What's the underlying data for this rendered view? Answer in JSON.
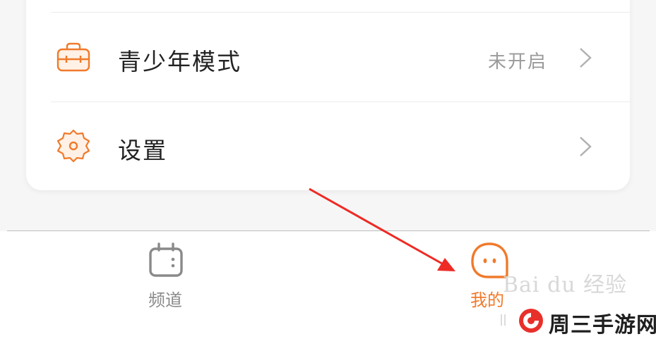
{
  "menu": {
    "teen_mode": {
      "label": "青少年模式",
      "status": "未开启",
      "icon": "briefcase-icon"
    },
    "settings": {
      "label": "设置",
      "icon": "gear-icon"
    }
  },
  "tabbar": {
    "items": [
      {
        "label": "频道",
        "icon": "calendar-icon",
        "active": false
      },
      {
        "label": "我的",
        "icon": "ghost-face-icon",
        "active": true
      }
    ]
  },
  "watermark": {
    "text": "Bai du 经验"
  },
  "brand": {
    "name": "周三手游网"
  },
  "colors": {
    "accent": "#f07a2b",
    "inactive": "#8a8a8a",
    "arrow": "#ee2a24"
  }
}
